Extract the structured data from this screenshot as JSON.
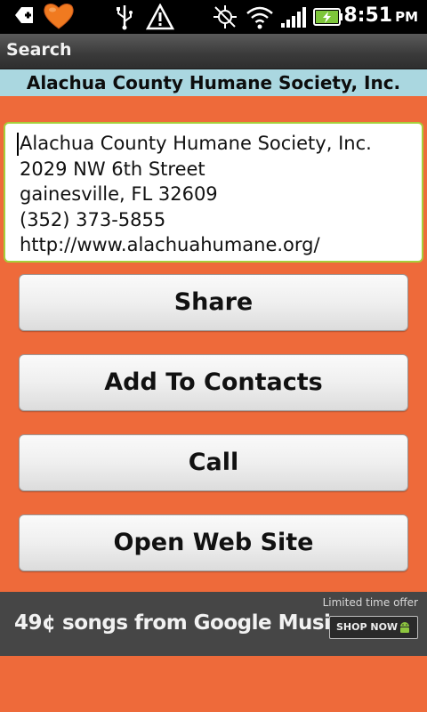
{
  "status_bar": {
    "time": "8:51",
    "ampm": "PM",
    "icons": [
      "add-contact-icon",
      "heart-icon",
      "usb-icon",
      "warning-icon",
      "gps-icon",
      "wifi-icon",
      "signal-icon",
      "battery-charging-icon"
    ]
  },
  "title_bar": {
    "title": "Search"
  },
  "org": {
    "name": "Alachua County Humane Society, Inc."
  },
  "address": {
    "lines": [
      "Alachua County Humane Society, Inc.",
      "2029 NW 6th Street",
      "gainesville, FL 32609",
      "(352) 373-5855",
      "http://www.alachuahumane.org/"
    ]
  },
  "buttons": {
    "share": "Share",
    "add_to_contacts": "Add To Contacts",
    "call": "Call",
    "open_web_site": "Open Web Site"
  },
  "ad": {
    "offer": "Limited time offer",
    "headline": "49¢ songs from Google Music.",
    "cta": "SHOP NOW"
  },
  "colors": {
    "background": "#ee6a3a",
    "header_bg": "#aad7e0",
    "input_border": "#a6cf3a",
    "heart": "#f07a20",
    "battery": "#7ec63b"
  }
}
